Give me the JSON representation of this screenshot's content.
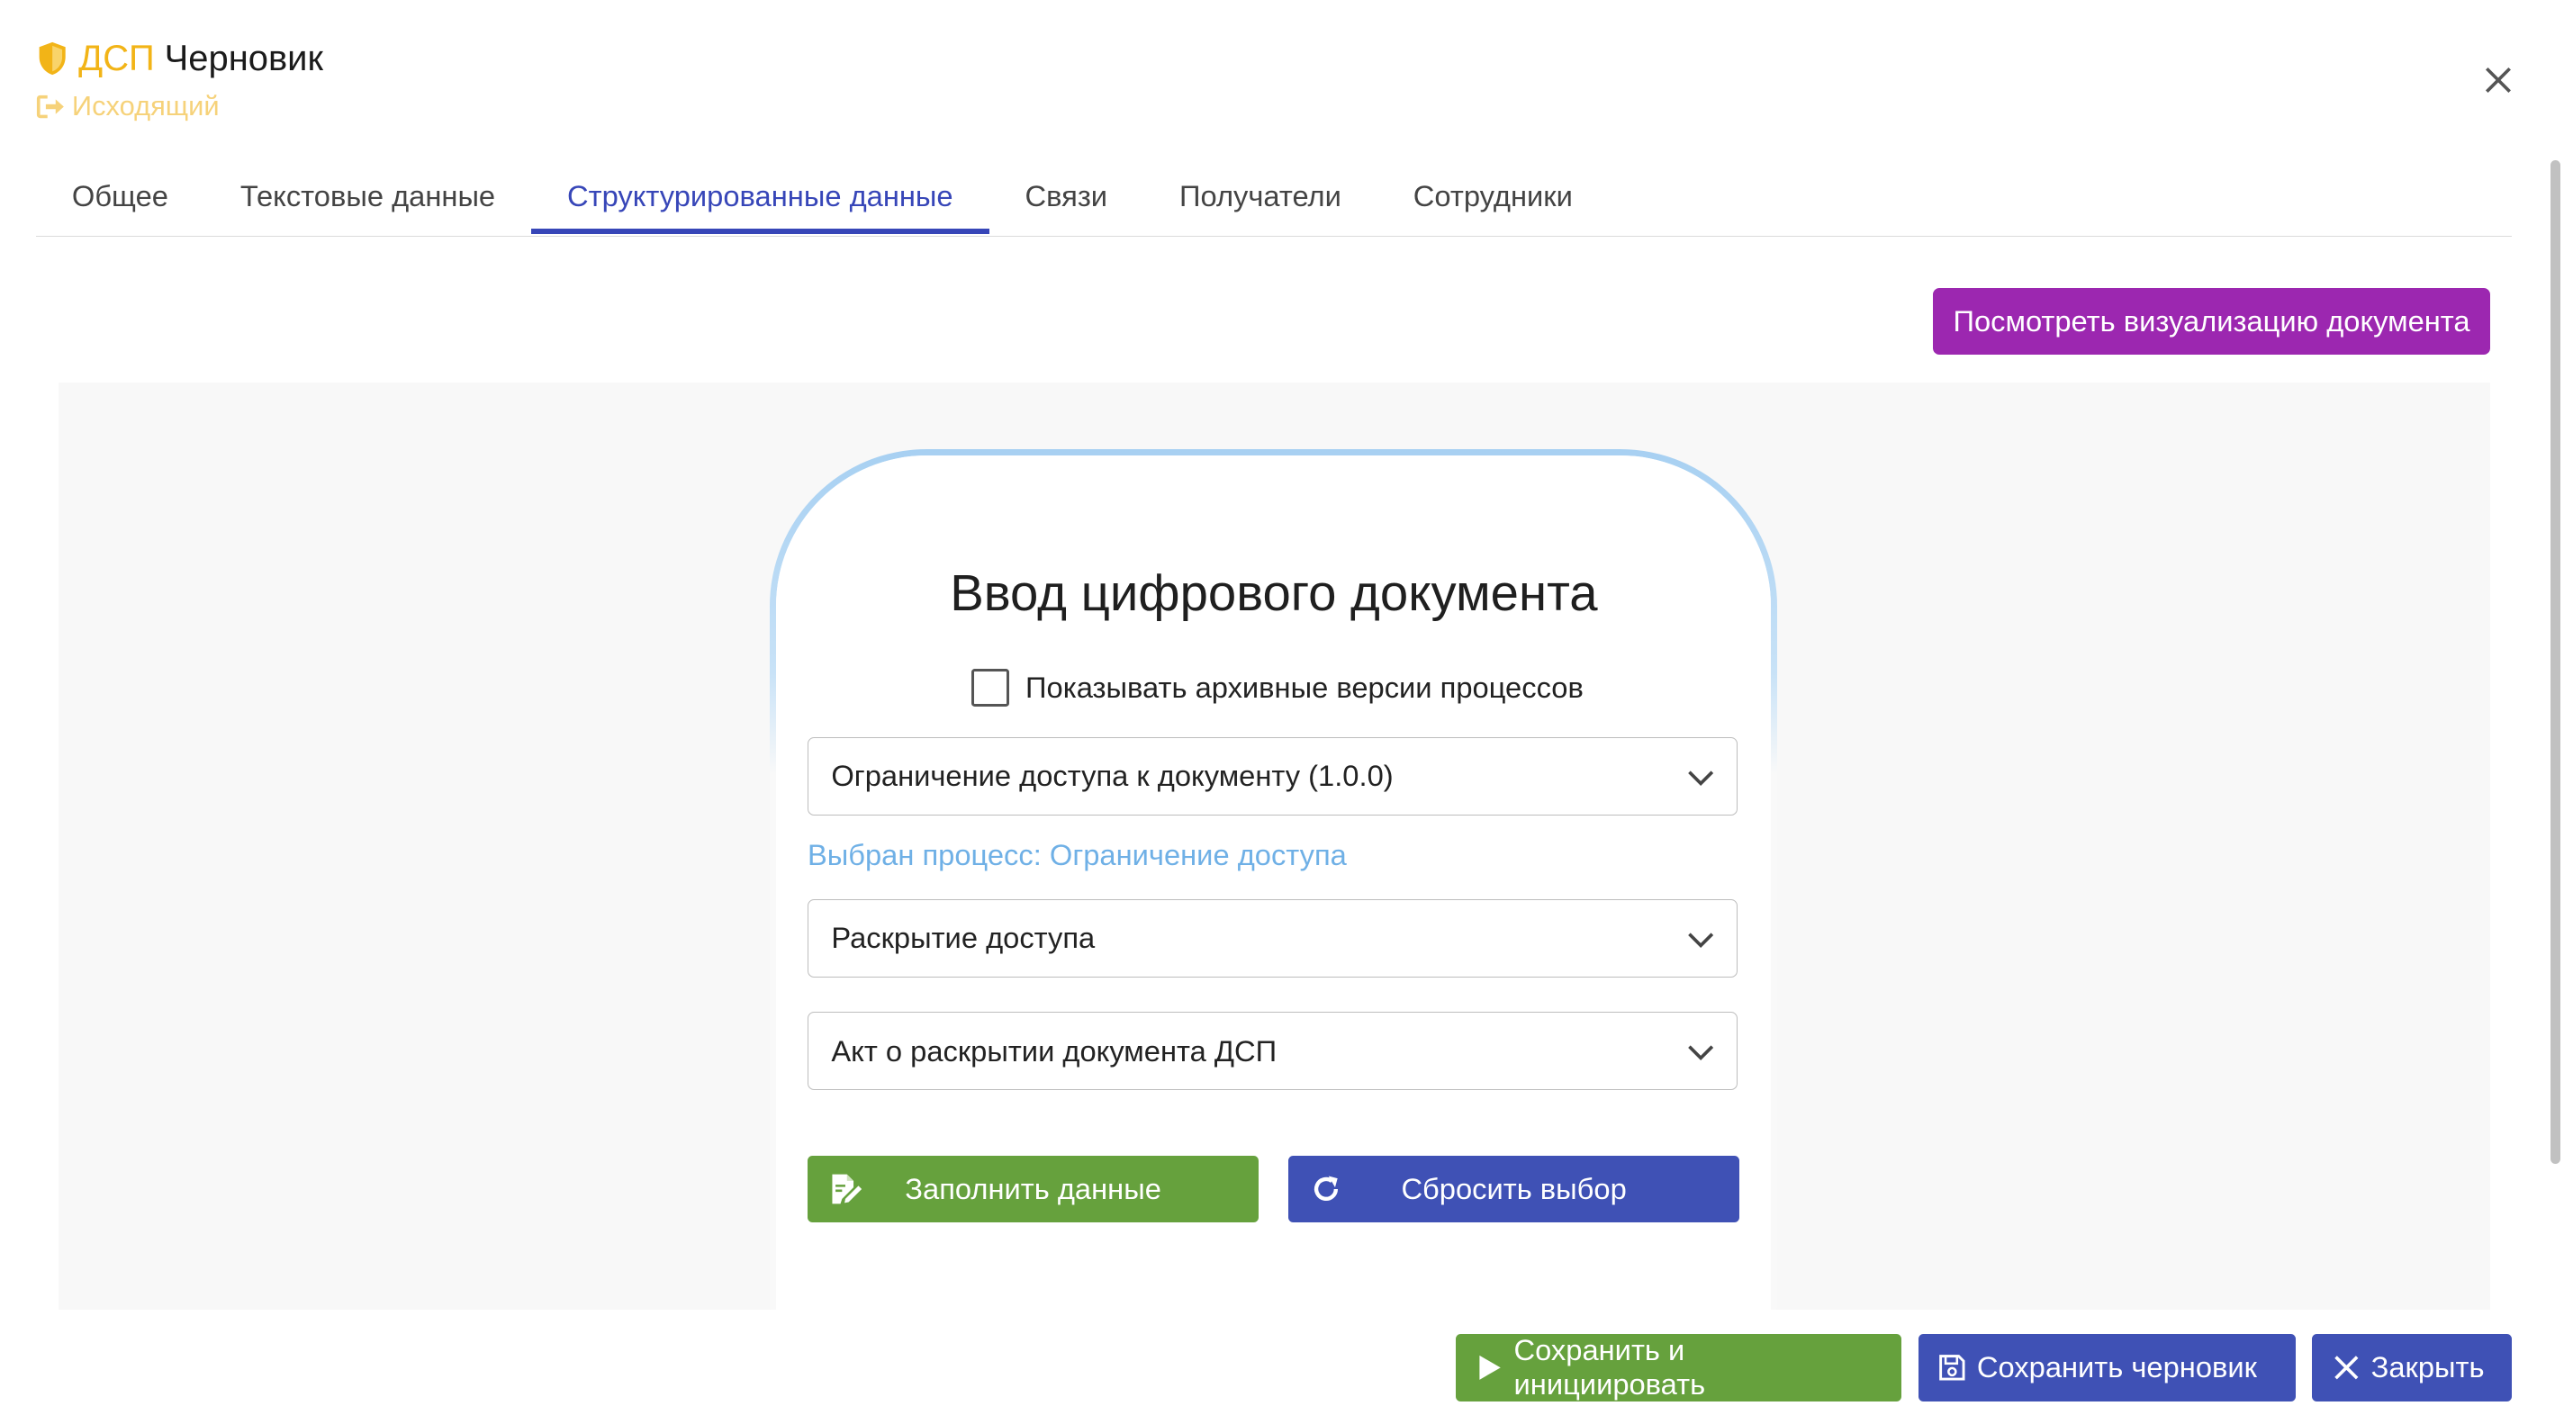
{
  "header": {
    "tag": "ДСП",
    "status": "Черновик",
    "direction": "Исходящий",
    "icons": {
      "tag": "shield-icon",
      "direction": "sign-out-icon",
      "close": "close-icon"
    }
  },
  "tabs": [
    {
      "label": "Общее",
      "active": false
    },
    {
      "label": "Текстовые данные",
      "active": false
    },
    {
      "label": "Структурированные данные",
      "active": true
    },
    {
      "label": "Связи",
      "active": false
    },
    {
      "label": "Получатели",
      "active": false
    },
    {
      "label": "Сотрудники",
      "active": false
    }
  ],
  "toolbar": {
    "visualize_label": "Посмотреть визуализацию документа"
  },
  "form": {
    "title": "Ввод цифрового документа",
    "show_archived_label": "Показывать архивные версии процессов",
    "show_archived_checked": false,
    "selects": [
      {
        "value": "Ограничение доступа к документу (1.0.0)"
      },
      {
        "value": "Раскрытие доступа"
      },
      {
        "value": "Акт о раскрытии документа ДСП"
      }
    ],
    "selected_process_note": "Выбран процесс: Ограничение доступа",
    "fill_label": "Заполнить данные",
    "reset_label": "Сбросить выбор"
  },
  "footer": {
    "save_init_label": "Сохранить и инициировать",
    "save_draft_label": "Сохранить черновик",
    "close_label": "Закрыть"
  },
  "colors": {
    "tag": "#f2b417",
    "direction": "#f6d27a",
    "active_tab": "#3746b8",
    "visualize": "#9c27b0",
    "green": "#66a13d",
    "indigo": "#3f51b5",
    "note": "#6fb0e6"
  }
}
